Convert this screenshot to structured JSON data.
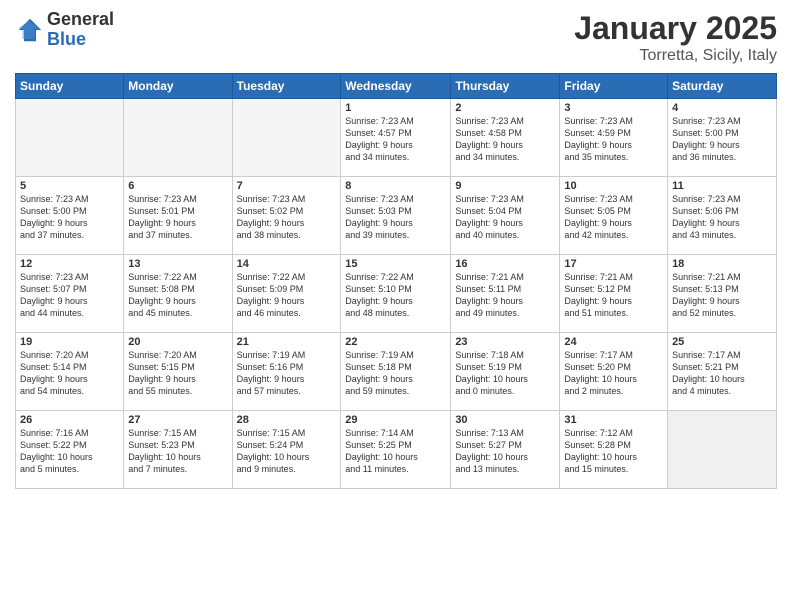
{
  "logo": {
    "general": "General",
    "blue": "Blue"
  },
  "title": "January 2025",
  "location": "Torretta, Sicily, Italy",
  "days": [
    "Sunday",
    "Monday",
    "Tuesday",
    "Wednesday",
    "Thursday",
    "Friday",
    "Saturday"
  ],
  "weeks": [
    [
      {
        "day": "",
        "content": ""
      },
      {
        "day": "",
        "content": ""
      },
      {
        "day": "",
        "content": ""
      },
      {
        "day": "1",
        "content": "Sunrise: 7:23 AM\nSunset: 4:57 PM\nDaylight: 9 hours\nand 34 minutes."
      },
      {
        "day": "2",
        "content": "Sunrise: 7:23 AM\nSunset: 4:58 PM\nDaylight: 9 hours\nand 34 minutes."
      },
      {
        "day": "3",
        "content": "Sunrise: 7:23 AM\nSunset: 4:59 PM\nDaylight: 9 hours\nand 35 minutes."
      },
      {
        "day": "4",
        "content": "Sunrise: 7:23 AM\nSunset: 5:00 PM\nDaylight: 9 hours\nand 36 minutes."
      }
    ],
    [
      {
        "day": "5",
        "content": "Sunrise: 7:23 AM\nSunset: 5:00 PM\nDaylight: 9 hours\nand 37 minutes."
      },
      {
        "day": "6",
        "content": "Sunrise: 7:23 AM\nSunset: 5:01 PM\nDaylight: 9 hours\nand 37 minutes."
      },
      {
        "day": "7",
        "content": "Sunrise: 7:23 AM\nSunset: 5:02 PM\nDaylight: 9 hours\nand 38 minutes."
      },
      {
        "day": "8",
        "content": "Sunrise: 7:23 AM\nSunset: 5:03 PM\nDaylight: 9 hours\nand 39 minutes."
      },
      {
        "day": "9",
        "content": "Sunrise: 7:23 AM\nSunset: 5:04 PM\nDaylight: 9 hours\nand 40 minutes."
      },
      {
        "day": "10",
        "content": "Sunrise: 7:23 AM\nSunset: 5:05 PM\nDaylight: 9 hours\nand 42 minutes."
      },
      {
        "day": "11",
        "content": "Sunrise: 7:23 AM\nSunset: 5:06 PM\nDaylight: 9 hours\nand 43 minutes."
      }
    ],
    [
      {
        "day": "12",
        "content": "Sunrise: 7:23 AM\nSunset: 5:07 PM\nDaylight: 9 hours\nand 44 minutes."
      },
      {
        "day": "13",
        "content": "Sunrise: 7:22 AM\nSunset: 5:08 PM\nDaylight: 9 hours\nand 45 minutes."
      },
      {
        "day": "14",
        "content": "Sunrise: 7:22 AM\nSunset: 5:09 PM\nDaylight: 9 hours\nand 46 minutes."
      },
      {
        "day": "15",
        "content": "Sunrise: 7:22 AM\nSunset: 5:10 PM\nDaylight: 9 hours\nand 48 minutes."
      },
      {
        "day": "16",
        "content": "Sunrise: 7:21 AM\nSunset: 5:11 PM\nDaylight: 9 hours\nand 49 minutes."
      },
      {
        "day": "17",
        "content": "Sunrise: 7:21 AM\nSunset: 5:12 PM\nDaylight: 9 hours\nand 51 minutes."
      },
      {
        "day": "18",
        "content": "Sunrise: 7:21 AM\nSunset: 5:13 PM\nDaylight: 9 hours\nand 52 minutes."
      }
    ],
    [
      {
        "day": "19",
        "content": "Sunrise: 7:20 AM\nSunset: 5:14 PM\nDaylight: 9 hours\nand 54 minutes."
      },
      {
        "day": "20",
        "content": "Sunrise: 7:20 AM\nSunset: 5:15 PM\nDaylight: 9 hours\nand 55 minutes."
      },
      {
        "day": "21",
        "content": "Sunrise: 7:19 AM\nSunset: 5:16 PM\nDaylight: 9 hours\nand 57 minutes."
      },
      {
        "day": "22",
        "content": "Sunrise: 7:19 AM\nSunset: 5:18 PM\nDaylight: 9 hours\nand 59 minutes."
      },
      {
        "day": "23",
        "content": "Sunrise: 7:18 AM\nSunset: 5:19 PM\nDaylight: 10 hours\nand 0 minutes."
      },
      {
        "day": "24",
        "content": "Sunrise: 7:17 AM\nSunset: 5:20 PM\nDaylight: 10 hours\nand 2 minutes."
      },
      {
        "day": "25",
        "content": "Sunrise: 7:17 AM\nSunset: 5:21 PM\nDaylight: 10 hours\nand 4 minutes."
      }
    ],
    [
      {
        "day": "26",
        "content": "Sunrise: 7:16 AM\nSunset: 5:22 PM\nDaylight: 10 hours\nand 5 minutes."
      },
      {
        "day": "27",
        "content": "Sunrise: 7:15 AM\nSunset: 5:23 PM\nDaylight: 10 hours\nand 7 minutes."
      },
      {
        "day": "28",
        "content": "Sunrise: 7:15 AM\nSunset: 5:24 PM\nDaylight: 10 hours\nand 9 minutes."
      },
      {
        "day": "29",
        "content": "Sunrise: 7:14 AM\nSunset: 5:25 PM\nDaylight: 10 hours\nand 11 minutes."
      },
      {
        "day": "30",
        "content": "Sunrise: 7:13 AM\nSunset: 5:27 PM\nDaylight: 10 hours\nand 13 minutes."
      },
      {
        "day": "31",
        "content": "Sunrise: 7:12 AM\nSunset: 5:28 PM\nDaylight: 10 hours\nand 15 minutes."
      },
      {
        "day": "",
        "content": ""
      }
    ]
  ]
}
